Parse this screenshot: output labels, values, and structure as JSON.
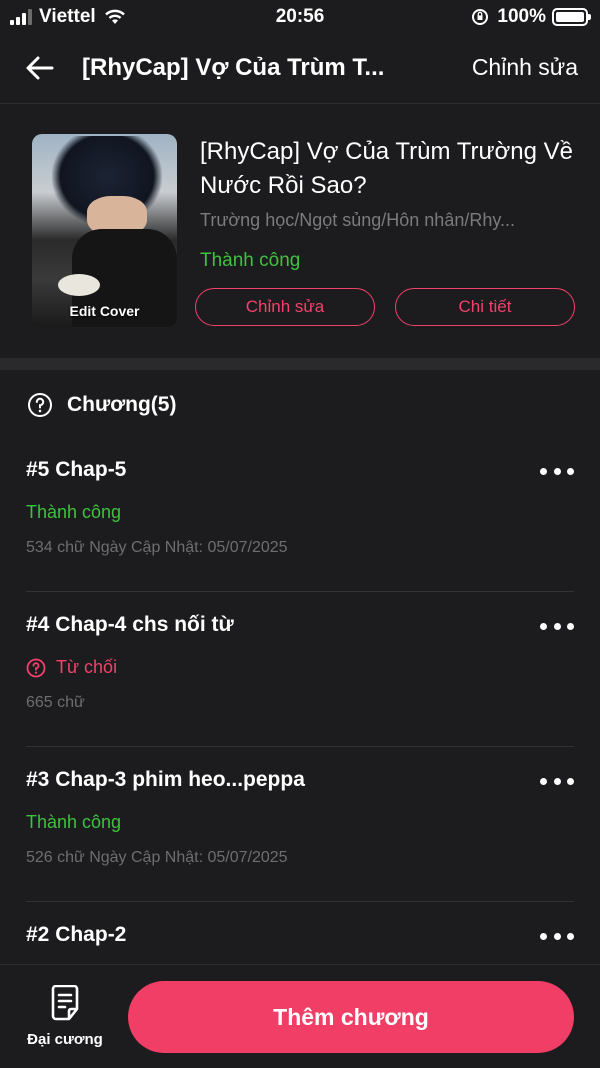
{
  "status_bar": {
    "carrier": "Viettel",
    "time": "20:56",
    "battery": "100%"
  },
  "nav": {
    "title": "[RhyCap] Vợ Của Trùm T...",
    "edit_label": "Chỉnh sửa"
  },
  "story": {
    "cover_label": "Edit Cover",
    "title": "[RhyCap] Vợ Của Trùm Trường Về Nước Rồi Sao?",
    "tags": "Trường học/Ngọt sủng/Hôn nhân/Rhy...",
    "status": "Thành công",
    "edit_button": "Chỉnh sửa",
    "detail_button": "Chi tiết"
  },
  "chapters_header": {
    "label": "Chương(5)"
  },
  "chapters": [
    {
      "title": "#5 Chap-5",
      "status": "Thành công",
      "status_type": "ok",
      "meta": "534 chữ Ngày Cập Nhật: 05/07/2025"
    },
    {
      "title": "#4 Chap-4 chs nối từ",
      "status": "Từ chối",
      "status_type": "rejected",
      "meta": "665 chữ"
    },
    {
      "title": "#3 Chap-3 phim heo...peppa",
      "status": "Thành công",
      "status_type": "ok",
      "meta": "526 chữ Ngày Cập Nhật: 05/07/2025"
    },
    {
      "title": "#2 Chap-2"
    }
  ],
  "bottom": {
    "outline_label": "Đại cương",
    "add_chapter_label": "Thêm chương"
  },
  "colors": {
    "accent": "#f13e66",
    "success": "#3ec23e",
    "background": "#1c1c1e"
  },
  "icons": [
    "back-arrow-icon",
    "help-circle-icon",
    "more-dots-icon",
    "document-icon",
    "signal-icon",
    "wifi-icon",
    "rotation-lock-icon",
    "battery-icon"
  ]
}
